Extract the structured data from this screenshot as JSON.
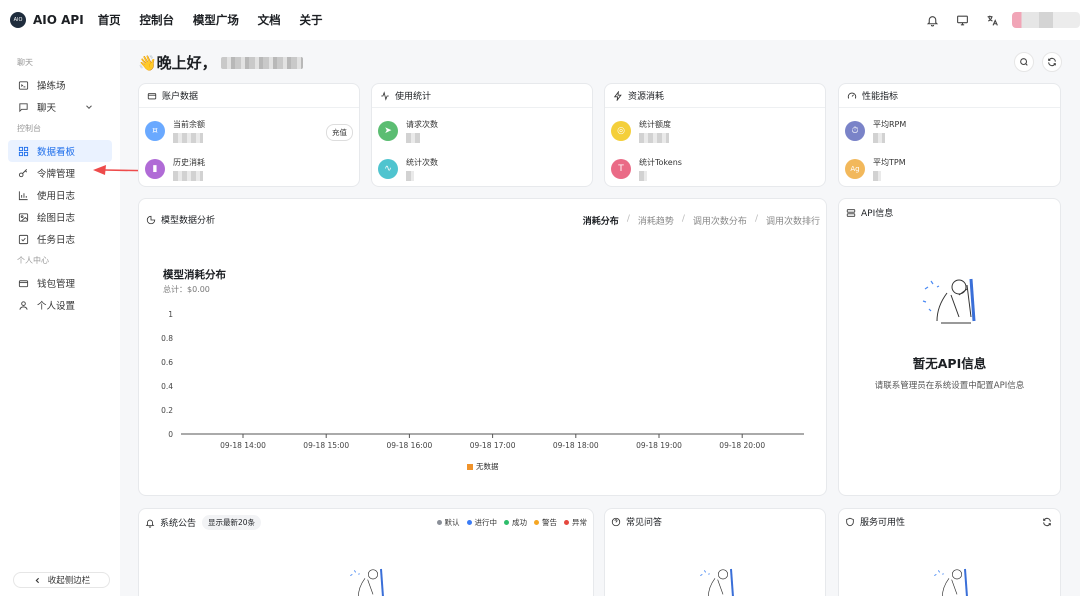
{
  "app": {
    "logo_text": "AIO",
    "name": "AIO API"
  },
  "nav": [
    "首页",
    "控制台",
    "模型广场",
    "文档",
    "关于"
  ],
  "topbar_icons": [
    "bell-icon",
    "monitor-icon",
    "translate-icon"
  ],
  "sidebar": {
    "sections": [
      {
        "title": "聊天",
        "items": [
          {
            "label": "操练场",
            "icon": "playground-icon"
          },
          {
            "label": "聊天",
            "icon": "chat-icon",
            "expandable": true
          }
        ]
      },
      {
        "title": "控制台",
        "items": [
          {
            "label": "数据看板",
            "icon": "dashboard-icon",
            "active": true
          },
          {
            "label": "令牌管理",
            "icon": "key-icon"
          },
          {
            "label": "使用日志",
            "icon": "bar-chart-icon"
          },
          {
            "label": "绘图日志",
            "icon": "image-icon"
          },
          {
            "label": "任务日志",
            "icon": "checklist-icon"
          }
        ]
      },
      {
        "title": "个人中心",
        "items": [
          {
            "label": "钱包管理",
            "icon": "wallet-icon"
          },
          {
            "label": "个人设置",
            "icon": "user-icon"
          }
        ]
      }
    ],
    "collapse_label": "收起侧边栏"
  },
  "greeting": "👋晚上好，",
  "cards": {
    "account": {
      "title": "账户数据",
      "balance_label": "当前余额",
      "consumed_label": "历史消耗",
      "recharge_label": "充值"
    },
    "usage": {
      "title": "使用统计",
      "requests_label": "请求次数",
      "count_label": "统计次数"
    },
    "resource": {
      "title": "资源消耗",
      "quota_label": "统计额度",
      "tokens_label": "统计Tokens"
    },
    "performance": {
      "title": "性能指标",
      "rpm_label": "平均RPM",
      "tpm_label": "平均TPM"
    }
  },
  "model_analysis": {
    "title": "模型数据分析",
    "tabs": [
      "消耗分布",
      "消耗趋势",
      "调用次数分布",
      "调用次数排行"
    ],
    "active_tab": 0,
    "chart_title": "模型消耗分布",
    "chart_subtitle": "总计：$0.00"
  },
  "chart_data": {
    "type": "bar",
    "categories": [
      "09-18 14:00",
      "09-18 15:00",
      "09-18 16:00",
      "09-18 17:00",
      "09-18 18:00",
      "09-18 19:00",
      "09-18 20:00"
    ],
    "series": [
      {
        "name": "无数据",
        "values": [
          0,
          0,
          0,
          0,
          0,
          0,
          0
        ]
      }
    ],
    "title": "模型消耗分布",
    "subtitle": "总计：$0.00",
    "yticks": [
      "1",
      "0.8",
      "0.6",
      "0.4",
      "0.2",
      "0"
    ],
    "ylim": [
      0,
      1
    ],
    "legend_color": "#f0932b",
    "legend_position": "bottom"
  },
  "api_info": {
    "title": "API信息",
    "empty_title": "暂无API信息",
    "empty_desc": "请联系管理员在系统设置中配置API信息"
  },
  "announcements": {
    "title": "系统公告",
    "badge": "显示最新20条",
    "legend": [
      {
        "label": "默认",
        "color": "#8a8f98"
      },
      {
        "label": "进行中",
        "color": "#3b7cf6"
      },
      {
        "label": "成功",
        "color": "#2ebd6b"
      },
      {
        "label": "警告",
        "color": "#f5a623"
      },
      {
        "label": "异常",
        "color": "#e5483e"
      }
    ]
  },
  "faq": {
    "title": "常见问答"
  },
  "availability": {
    "title": "服务可用性"
  },
  "colors": {
    "accent": "#1f6feb",
    "arrow": "#ee4b4b"
  }
}
